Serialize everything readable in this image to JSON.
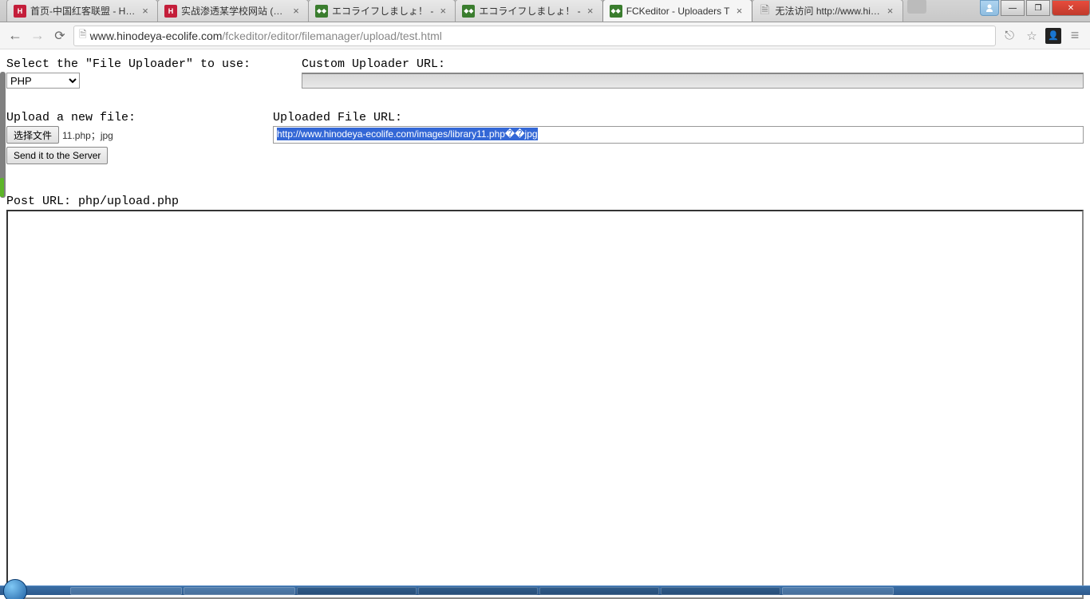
{
  "tabs": [
    {
      "title": "首页-中国红客联盟 - Hon",
      "favicon": "H",
      "faviconClass": "favicon-red"
    },
    {
      "title": "实战渗透某学校网站 (gov",
      "favicon": "H",
      "faviconClass": "favicon-red"
    },
    {
      "title": "エコライフしましょ！ - ",
      "favicon": "◆◆",
      "faviconClass": "favicon-green"
    },
    {
      "title": "エコライフしましょ！ - ",
      "favicon": "◆◆",
      "faviconClass": "favicon-green"
    },
    {
      "title": "FCKeditor - Uploaders T",
      "favicon": "◆◆",
      "faviconClass": "favicon-green",
      "active": true
    },
    {
      "title": "无法访问 http://www.hino",
      "favicon": "🗎",
      "faviconClass": "favicon-doc"
    }
  ],
  "url": {
    "domain": "www.hinodeya-ecolife.com",
    "path": "/fckeditor/editor/filemanager/upload/test.html"
  },
  "page": {
    "select_label": "Select the \"File Uploader\" to use:",
    "uploader_value": "PHP",
    "custom_label": "Custom Uploader URL:",
    "custom_value": "",
    "upload_label": "Upload a new file:",
    "choose_file_btn": "选择文件",
    "chosen_file": "11.php；jpg",
    "send_btn": "Send it to the Server",
    "uploaded_label": "Uploaded File URL:",
    "uploaded_value": "http://www.hinodeya-ecolife.com/images/library11.php��jpg",
    "post_url_label": "Post URL: ",
    "post_url_value": "php/upload.php"
  }
}
